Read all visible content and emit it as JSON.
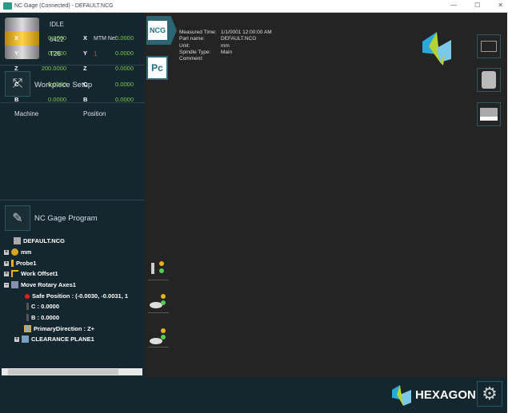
{
  "window": {
    "title": "NC Gage (Connected) - DEFAULT.NCG",
    "minimize": "—",
    "maximize": "☐",
    "close": "✕"
  },
  "status": {
    "state": "IDLE",
    "number": "6422",
    "mode": "MTM Net",
    "tool": "T26",
    "count": "1"
  },
  "workpiece_setup": {
    "label": "Workpiece Setup"
  },
  "coords": {
    "machine_header": "Machine",
    "position_header": "Position",
    "rows": [
      {
        "axis": "X",
        "machine": "0.0000",
        "position": "0.0000"
      },
      {
        "axis": "Y",
        "machine": "0.0000",
        "position": "0.0000"
      },
      {
        "axis": "Z",
        "machine": "200.0000",
        "position": "0.0000"
      },
      {
        "axis": "C",
        "machine": "0.0000",
        "position": "0.0000"
      },
      {
        "axis": "B",
        "machine": "0.0000",
        "position": "0.0000"
      }
    ]
  },
  "program": {
    "label": "NC Gage Program"
  },
  "tree": {
    "root": "DEFAULT.NCG",
    "mm": "mm",
    "probe": "Probe1",
    "work_offset": "Work Offset1",
    "move_rotary": "Move Rotary Axes1",
    "safe_position": "Safe Position : (-0.0030, -0.0031, 1",
    "c": "C : 0.0000",
    "b": "B : 0.0000",
    "primary_direction": "PrimaryDirection : Z+",
    "clearance": "CLEARANCE PLANE1"
  },
  "tabs": {
    "ncg": "NCG",
    "pc": "Pc"
  },
  "meta": {
    "measured_time_label": "Measured Time:",
    "measured_time": "1/1/0001 12:00:00 AM",
    "part_name_label": "Part name:",
    "part_name": "DEFAULT.NCG",
    "unit_label": "Unit:",
    "unit": "mm",
    "spindle_label": "Spindle Type:",
    "spindle": "Main",
    "comment_label": "Comment:"
  },
  "brand": {
    "name": "HEXAGON"
  },
  "colors": {
    "green": "#7ec850",
    "accent": "#e6b020"
  }
}
